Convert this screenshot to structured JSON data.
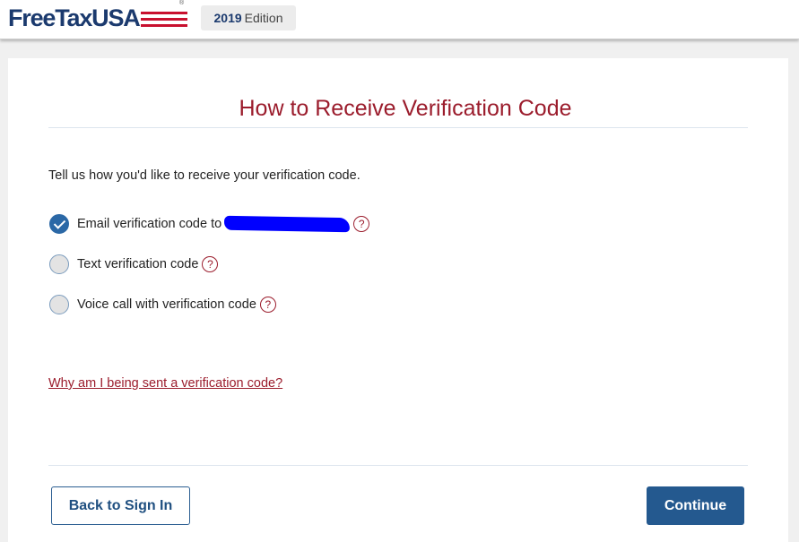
{
  "header": {
    "logo_text": "FreeTaxUSA",
    "logo_mark": "®",
    "edition_year": "2019",
    "edition_label": "Edition"
  },
  "page": {
    "title": "How to Receive Verification Code",
    "intro": "Tell us how you'd like to receive your verification code."
  },
  "options": [
    {
      "label": "Email verification code to",
      "selected": true,
      "help_icon": "question-circle-icon"
    },
    {
      "label": "Text verification code",
      "selected": false,
      "help_icon": "question-circle-icon"
    },
    {
      "label": "Voice call with verification code",
      "selected": false,
      "help_icon": "question-circle-icon"
    }
  ],
  "help_glyph": "?",
  "why_link": "Why am I being sent a verification code?",
  "buttons": {
    "back": "Back to Sign In",
    "continue": "Continue"
  },
  "colors": {
    "brand_navy": "#1b3a6e",
    "brand_red": "#9b1c2c",
    "button_blue": "#24598f",
    "redaction": "#0000ff"
  }
}
